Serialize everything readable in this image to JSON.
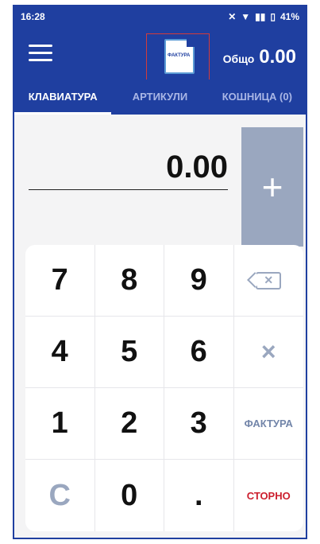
{
  "status": {
    "time": "16:28",
    "battery": "41%"
  },
  "header": {
    "logo_text": "ФАКТУРА",
    "total_label": "Общо",
    "total_value": "0.00"
  },
  "tabs": [
    {
      "label": "КЛАВИАТУРА",
      "active": true
    },
    {
      "label": "АРТИКУЛИ",
      "active": false
    },
    {
      "label": "КОШНИЦА (0)",
      "active": false
    }
  ],
  "amount": {
    "value": "0.00"
  },
  "plus": {
    "label": "+"
  },
  "keypad": {
    "keys": [
      "7",
      "8",
      "9",
      "",
      "4",
      "5",
      "6",
      "×",
      "1",
      "2",
      "3",
      "ФАКТУРА",
      "C",
      "0",
      ".",
      "СТОРНО"
    ]
  }
}
